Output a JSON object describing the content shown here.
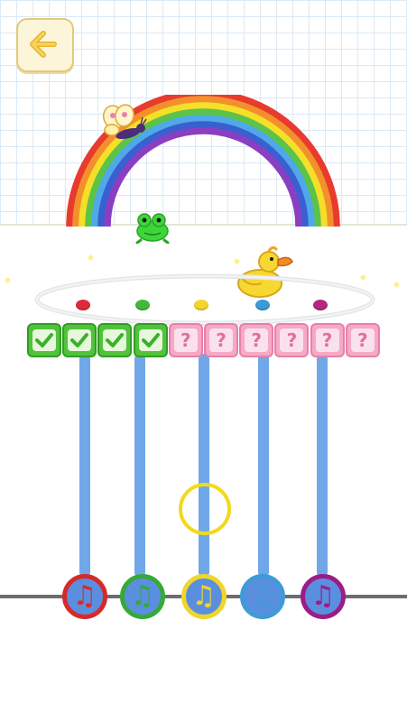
{
  "header": {
    "back_icon": "arrow-left-icon"
  },
  "scene": {
    "rainbow_colors": [
      "#e83b2e",
      "#f2912b",
      "#f5df29",
      "#5cc34a",
      "#4fa8e8",
      "#3a5fd0",
      "#8a3fc2"
    ],
    "characters": [
      "butterfly",
      "frog",
      "duck"
    ]
  },
  "track_dots": {
    "colors": [
      "#e02a3a",
      "#41b93a",
      "#f3d52b",
      "#3a9bd6",
      "#b3287e"
    ]
  },
  "progress": {
    "total": 10,
    "completed": 4,
    "done_icon": "checkmark-icon",
    "pending_symbol": "?"
  },
  "notes": [
    {
      "color": "#d62a2a",
      "face": "#5a8fe0",
      "symbol": "♫"
    },
    {
      "color": "#37a83a",
      "face": "#5a8fe0",
      "symbol": "♫"
    },
    {
      "color": "#f0d52b",
      "face": "#5a8fe0",
      "symbol": "♫"
    },
    {
      "color": "#3f9bd7",
      "face": "#5a8fe0",
      "symbol": "♫"
    },
    {
      "color": "#9c1c86",
      "face": "#5a8fe0",
      "symbol": "♫"
    }
  ]
}
